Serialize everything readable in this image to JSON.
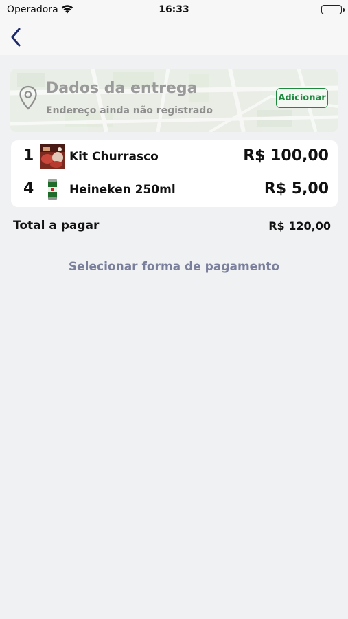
{
  "status_bar": {
    "carrier": "Operadora",
    "time": "16:33"
  },
  "nav": {
    "back_icon": "chevron-left-icon"
  },
  "delivery": {
    "title": "Dados da entrega",
    "subtitle": "Endereço ainda não registrado",
    "add_label": "Adicionar",
    "icon": "location-pin-icon"
  },
  "items": [
    {
      "qty": "1",
      "name": "Kit Churrasco",
      "price": "R$ 100,00",
      "icon": "barbecue-kit-thumbnail"
    },
    {
      "qty": "4",
      "name": "Heineken 250ml",
      "price": "R$ 5,00",
      "icon": "beer-can-thumbnail"
    }
  ],
  "total": {
    "label": "Total a pagar",
    "value": "R$ 120,00"
  },
  "payment": {
    "label": "Selecionar forma de pagamento"
  },
  "colors": {
    "background": "#f0f1f3",
    "accent_green": "#1f8a3f",
    "back_icon": "#1c2a6b",
    "link": "#7a7f9c"
  }
}
